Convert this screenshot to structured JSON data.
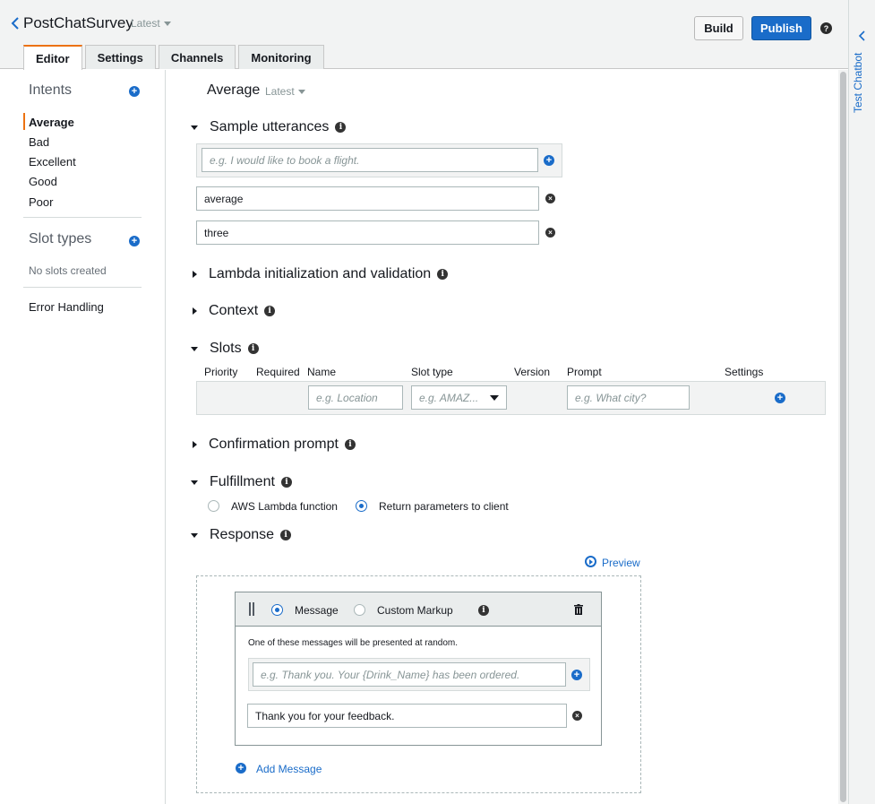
{
  "header": {
    "bot_name": "PostChatSurvey",
    "version": "Latest",
    "build_label": "Build",
    "publish_label": "Publish",
    "help_glyph": "?",
    "tabs": [
      {
        "label": "Editor",
        "active": true
      },
      {
        "label": "Settings",
        "active": false
      },
      {
        "label": "Channels",
        "active": false
      },
      {
        "label": "Monitoring",
        "active": false
      }
    ]
  },
  "sidebar": {
    "intents_heading": "Intents",
    "intents": [
      {
        "label": "Average",
        "active": true
      },
      {
        "label": "Bad",
        "active": false
      },
      {
        "label": "Excellent",
        "active": false
      },
      {
        "label": "Good",
        "active": false
      },
      {
        "label": "Poor",
        "active": false
      }
    ],
    "slot_types_heading": "Slot types",
    "no_slots_text": "No slots created",
    "error_handling_label": "Error Handling"
  },
  "intent": {
    "name": "Average",
    "version": "Latest",
    "sample_utterances": {
      "title": "Sample utterances",
      "placeholder": "e.g. I would like to book a flight.",
      "items": [
        "average",
        "three"
      ]
    },
    "lambda_section_title": "Lambda initialization and validation",
    "context_section_title": "Context",
    "slots": {
      "title": "Slots",
      "columns": [
        "Priority",
        "Required",
        "Name",
        "Slot type",
        "Version",
        "Prompt",
        "Settings"
      ],
      "name_placeholder": "e.g. Location",
      "type_placeholder": "e.g. AMAZ...",
      "prompt_placeholder": "e.g. What city?"
    },
    "confirmation_section_title": "Confirmation prompt",
    "fulfillment": {
      "title": "Fulfillment",
      "options": [
        "AWS Lambda function",
        "Return parameters to client"
      ],
      "selected": "Return parameters to client"
    },
    "response": {
      "title": "Response",
      "preview_label": "Preview",
      "type_options": [
        "Message",
        "Custom Markup"
      ],
      "selected_type": "Message",
      "note": "One of these messages will be presented at random.",
      "message_placeholder": "e.g. Thank you. Your {Drink_Name} has been ordered.",
      "messages": [
        "Thank you for your feedback."
      ],
      "add_message_label": "Add Message"
    }
  },
  "right_panel": {
    "label": "Test Chatbot"
  },
  "colors": {
    "accent_orange": "#ec7211",
    "primary_blue": "#1a6cc9"
  }
}
